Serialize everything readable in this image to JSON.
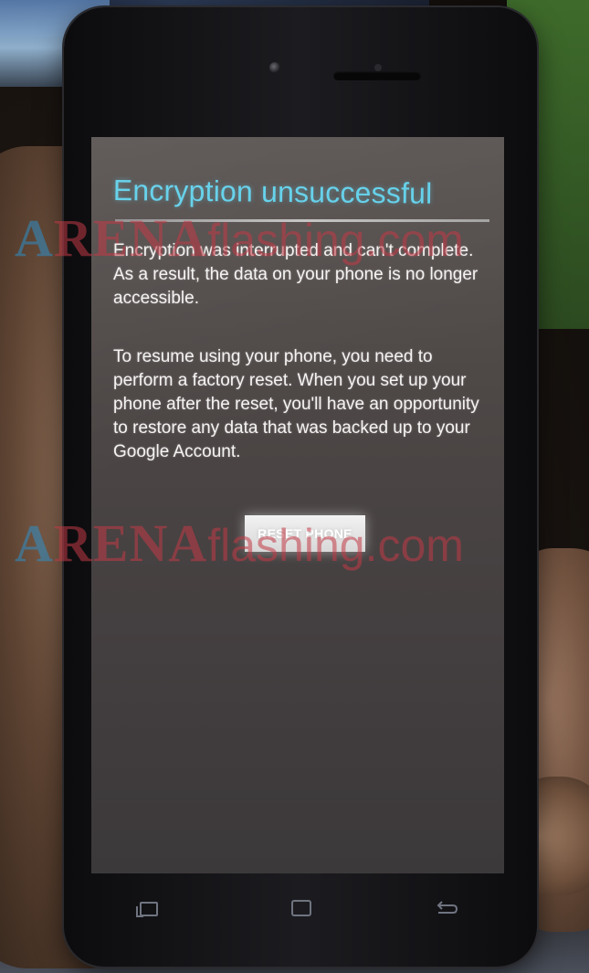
{
  "screen": {
    "title": "Encryption unsuccessful",
    "paragraph_1": "Encryption was interrupted and can't complete. As a result, the data on your phone is no longer accessible.",
    "paragraph_2": "To resume using your phone, you need to perform a factory reset. When you set up your phone after the reset, you'll have an opportunity to restore any data that was backed up to your Google Account.",
    "reset_button_label": "RESET PHONE",
    "title_color": "#62d0ea"
  },
  "watermark": {
    "arena_first": "A",
    "arena_rest": "RENA",
    "suffix": "flashing.com"
  },
  "nav_keys": {
    "recent": "recent-apps-icon",
    "home": "home-icon",
    "back": "back-arrow-icon"
  }
}
